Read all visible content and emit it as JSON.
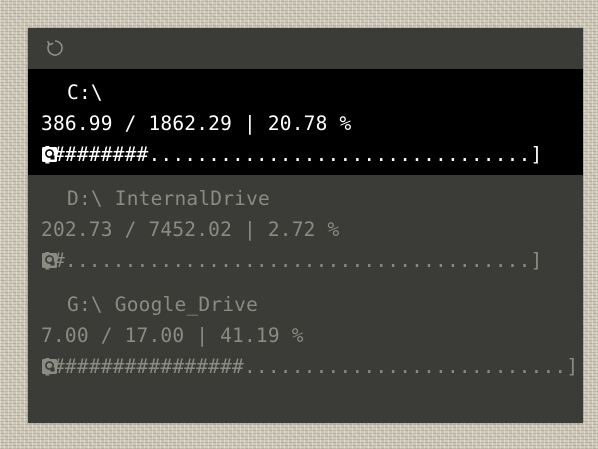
{
  "toolbar": {
    "refresh_icon": "refresh-icon"
  },
  "drives": [
    {
      "name": "C:\\",
      "usage": "386.99 / 1862.29 | 20.78 %",
      "percent": 20.78,
      "bar": "[########................................]",
      "active": true,
      "icon": "disk-icon"
    },
    {
      "name": "D:\\ InternalDrive",
      "usage": "202.73 / 7452.02 | 2.72 %",
      "percent": 2.72,
      "bar": "[#.......................................]",
      "active": false,
      "icon": "disk-icon"
    },
    {
      "name": "G:\\ Google_Drive",
      "usage": "7.00 / 17.00 | 41.19 %",
      "percent": 41.19,
      "bar": "[################...........................]",
      "active": false,
      "icon": "disk-icon"
    }
  ],
  "colors": {
    "widget_bg": "#3b3b37",
    "active_bg": "#000000",
    "active_text": "#ffffff",
    "inactive_text": "#8b8b84"
  }
}
